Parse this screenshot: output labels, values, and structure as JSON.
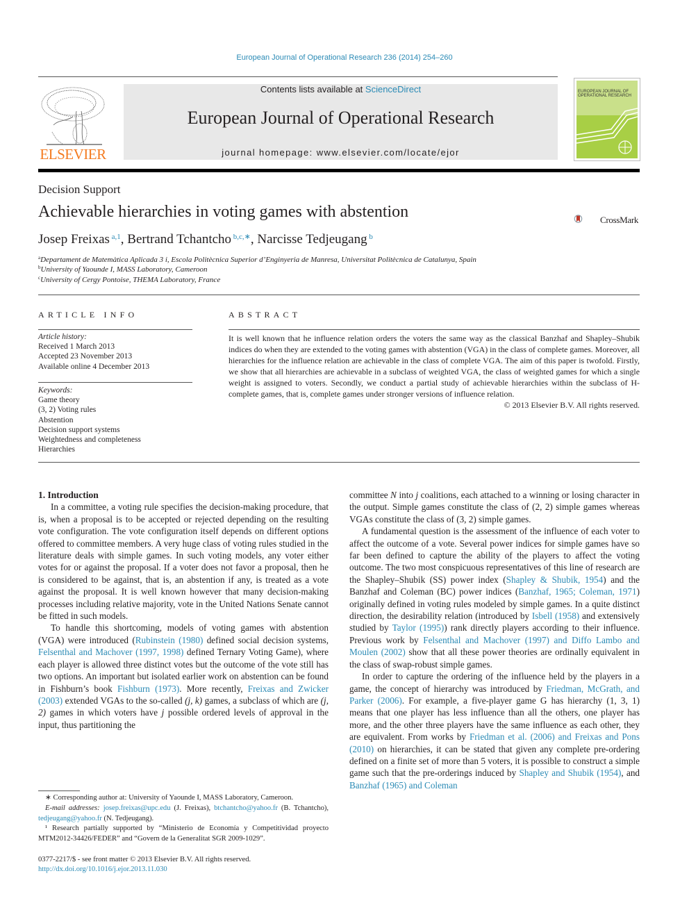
{
  "header": {
    "running_head": "European Journal of Operational Research 236 (2014) 254–260",
    "contents_prefix": "Contents lists available at ",
    "contents_link": "ScienceDirect",
    "journal_title": "European Journal of Operational Research",
    "homepage_prefix": "journal homepage: ",
    "homepage_url": "www.elsevier.com/locate/ejor",
    "publisher_wordmark": "ELSEVIER",
    "cover_title_line1": "EUROPEAN JOURNAL OF",
    "cover_title_line2": "OPERATIONAL RESEARCH",
    "crossmark_label": "CrossMark"
  },
  "article": {
    "section": "Decision Support",
    "title": "Achievable hierarchies in voting games with abstention",
    "authors": [
      {
        "name": "Josep Freixas",
        "sup": "a,1"
      },
      {
        "name": "Bertrand Tchantcho",
        "sup": "b,c,∗"
      },
      {
        "name": "Narcisse Tedjeugang",
        "sup": "b"
      }
    ],
    "affiliations": [
      {
        "sup": "a",
        "text": "Departament de Matemàtica Aplicada 3 i, Escola Politècnica Superior d’Enginyeria de Manresa, Universitat Politècnica de Catalunya, Spain"
      },
      {
        "sup": "b",
        "text": "University of Yaounde I, MASS Laboratory, Cameroon"
      },
      {
        "sup": "c",
        "text": "University of Cergy Pontoise, THEMA Laboratory, France"
      }
    ]
  },
  "article_info": {
    "heading": "ARTICLE INFO",
    "history_label": "Article history:",
    "history": [
      "Received 1 March 2013",
      "Accepted 23 November 2013",
      "Available online 4 December 2013"
    ],
    "keywords_label": "Keywords:",
    "keywords": [
      "Game theory",
      "(3, 2) Voting rules",
      "Abstention",
      "Decision support systems",
      "Weightedness and completeness",
      "Hierarchies"
    ]
  },
  "abstract": {
    "heading": "ABSTRACT",
    "text": "It is well known that he influence relation orders the voters the same way as the classical Banzhaf and Shapley–Shubik indices do when they are extended to the voting games with abstention (VGA) in the class of complete games. Moreover, all hierarchies for the influence relation are achievable in the class of complete VGA. The aim of this paper is twofold. Firstly, we show that all hierarchies are achievable in a subclass of weighted VGA, the class of weighted games for which a single weight is assigned to voters. Secondly, we conduct a partial study of achievable hierarchies within the subclass of H-complete games, that is, complete games under stronger versions of influence relation.",
    "copyright": "© 2013 Elsevier B.V. All rights reserved."
  },
  "body": {
    "intro_heading": "1. Introduction",
    "p1": "In a committee, a voting rule specifies the decision-making procedure, that is, when a proposal is to be accepted or rejected depending on the resulting vote configuration. The vote configuration itself depends on different options offered to committee members. A very huge class of voting rules studied in the literature deals with simple games. In such voting models, any voter either votes for or against the proposal. If a voter does not favor a proposal, then he is considered to be against, that is, an abstention if any, is treated as a vote against the proposal. It is well known however that many decision-making processes including relative majority, vote in the United Nations Senate cannot be fitted in such models.",
    "p2": {
      "t1": "To handle this shortcoming, models of voting games with abstention (VGA) were introduced (",
      "c1": "Rubinstein (1980)",
      "t2": " defined social decision systems, ",
      "c2": "Felsenthal and Machover (1997, 1998)",
      "t3": " defined Ternary Voting Game), where each player is allowed three distinct votes but the outcome of the vote still has two options. An important but isolated earlier work on abstention can be found in Fishburn’s book ",
      "c3": "Fishburn (1973)",
      "t4": ". More recently, ",
      "c4": "Freixas and Zwicker (2003)",
      "t5": " extended VGAs to the so-called ",
      "m1": "(j, k)",
      "t6": " games, a subclass of which are ",
      "m2": "(j, 2)",
      "t7": " games in which voters have ",
      "m3": "j",
      "t8": " possible ordered levels of approval in the input, thus partitioning the committee ",
      "m4": "N",
      "t9": " into ",
      "m5": "j",
      "t10": " coalitions, each attached to a winning or losing character in the output. Simple games constitute the class of (2, 2) simple games whereas VGAs constitute the class of (3, 2) simple games."
    },
    "p3": {
      "t1": "A fundamental question is the assessment of the influence of each voter to affect the outcome of a vote. Several power indices for simple games have so far been defined to capture the ability of the players to affect the voting outcome. The two most conspicuous representatives of this line of research are the Shapley–Shubik (SS) power index (",
      "c1": "Shapley & Shubik, 1954",
      "t2": ") and the Banzhaf and Coleman (BC) power indices (",
      "c2": "Banzhaf, 1965; Coleman, 1971",
      "t3": ") originally defined in voting rules modeled by simple games. In a quite distinct direction, the desirability relation (introduced by ",
      "c3": "Isbell (1958)",
      "t4": " and extensively studied by ",
      "c4": "Taylor (1995)",
      "t5": ") rank directly players according to their influence. Previous work by ",
      "c5": "Felsenthal and Machover (1997) and Diffo Lambo and Moulen (2002)",
      "t6": " show that all these power theories are ordinally equivalent in the class of swap-robust simple games."
    },
    "p4": {
      "t1": "In order to capture the ordering of the influence held by the players in a game, the concept of hierarchy was introduced by ",
      "c1": "Friedman, McGrath, and Parker (2006)",
      "t2": ". For example, a five-player game G has hierarchy (1, 3, 1) means that one player has less influence than all the others, one player has more, and the other three players have the same influence as each other, they are equivalent. From works by ",
      "c2": "Friedman et al. (2006) and Freixas and Pons (2010)",
      "t3": " on hierarchies, it can be stated that given any complete pre-ordering defined on a finite set of more than 5 voters, it is possible to construct a simple game such that the pre-orderings induced by ",
      "c3": "Shapley and Shubik (1954)",
      "t4": ", and ",
      "c4": "Banzhaf (1965) and Coleman"
    }
  },
  "footnotes": {
    "corresponding": "∗ Corresponding author at: University of Yaounde I, MASS Laboratory, Cameroon.",
    "email_label": "E-mail addresses:",
    "emails": [
      {
        "address": "josep.freixas@upc.edu",
        "who": "(J. Freixas),"
      },
      {
        "address": "btchantcho@yahoo.fr",
        "who": "(B. Tchantcho),"
      },
      {
        "address": "tedjeugang@yahoo.fr",
        "who": "(N. Tedjeugang)."
      }
    ],
    "funding": "¹ Research partially supported by “Ministerio de Economía y Competitividad proyecto MTM2012-34426/FEDER” and “Govern de la Generalitat SGR 2009-1029”.",
    "front_matter": "0377-2217/$ - see front matter © 2013 Elsevier B.V. All rights reserved.",
    "doi": "http://dx.doi.org/10.1016/j.ejor.2013.11.030"
  },
  "colors": {
    "link": "#2a8ab5",
    "elsevier_orange": "#f47b20",
    "cover_green": "#a8cf45",
    "masthead_gray": "#e8e8e8"
  }
}
